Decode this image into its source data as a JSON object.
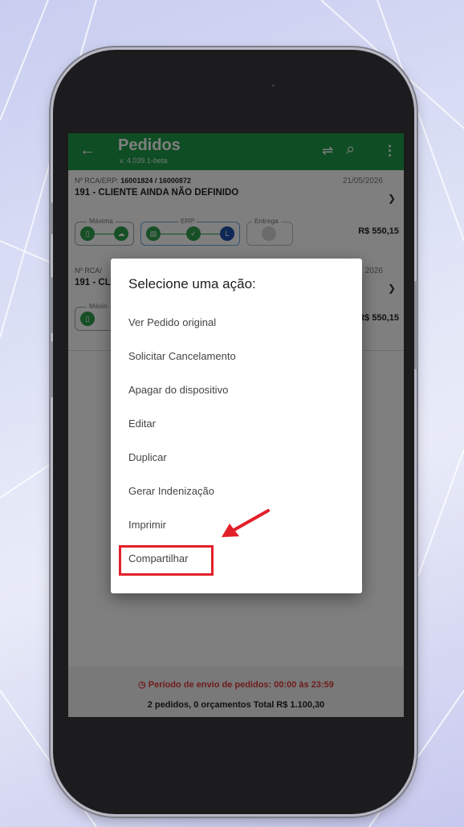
{
  "colors": {
    "appbar": "#1f9a48",
    "accent_red": "#e2202a",
    "period_text": "#e0393a",
    "status_green": "#2e9e4c",
    "status_blue": "#1f4ea8"
  },
  "app": {
    "title": "Pedidos",
    "version": "v. 4.039.1-beta",
    "back_icon": "←",
    "filter_icon": "⇌",
    "search_icon": "⌕",
    "menu_icon": "⋮"
  },
  "orders": [
    {
      "meta_label": "Nº RCA/ERP: ",
      "meta_value": "16001824 / 16000872",
      "date": "21/05/2026",
      "client": "191 - CLIENTE AINDA NÃO DEFINIDO",
      "groups": [
        "Máxima",
        "ERP",
        "Entrega"
      ],
      "total": "R$ 550,15"
    },
    {
      "meta_label": "Nº RCA/",
      "date": "2026",
      "client": "191 - CL",
      "groups": [
        "Máxin"
      ],
      "total": "R$ 550,15"
    }
  ],
  "status_icons": [
    "device-icon",
    "cloud-icon",
    "calendar-icon",
    "check-icon",
    "L"
  ],
  "dialog": {
    "title": "Selecione uma ação:",
    "options": [
      "Ver Pedido original",
      "Solicitar Cancelamento",
      "Apagar do dispositivo",
      "Editar",
      "Duplicar",
      "Gerar Indenização",
      "Imprimir",
      "Compartilhar"
    ]
  },
  "footer": {
    "period": "Período de envio de pedidos: 00:00 às 23:59",
    "summary": "2 pedidos, 0 orçamentos   Total R$ 1.100,30"
  }
}
